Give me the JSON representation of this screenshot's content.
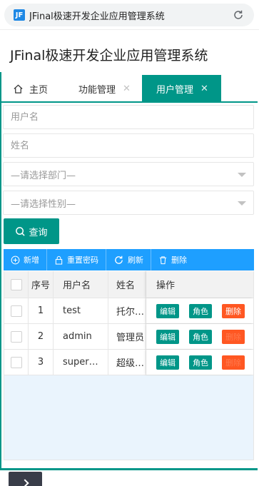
{
  "browser": {
    "address_text": "JFinal极速开发企业应用管理系统",
    "favicon_letter": "JF"
  },
  "app": {
    "title": "JFinal极速开发企业应用管理系统"
  },
  "tabs": [
    {
      "label": "主页",
      "closable": false,
      "active": false
    },
    {
      "label": "功能管理",
      "closable": true,
      "active": false
    },
    {
      "label": "用户管理",
      "closable": true,
      "active": true
    }
  ],
  "close_glyph": "✕",
  "form": {
    "username_placeholder": "用户名",
    "name_placeholder": "姓名",
    "department_value": "—请选择部门—",
    "gender_value": "—请选择性别—",
    "search_label": "查询"
  },
  "toolbar": {
    "add_label": "新增",
    "reset_password_label": "重置密码",
    "refresh_label": "刷新",
    "delete_label": "删除"
  },
  "table": {
    "headers": {
      "index": "序号",
      "username": "用户名",
      "name": "姓名",
      "actions": "操作"
    },
    "rows": [
      {
        "index": "1",
        "username": "test",
        "name": "托尔…"
      },
      {
        "index": "2",
        "username": "admin",
        "name": "管理员"
      },
      {
        "index": "3",
        "username": "super…",
        "name": "超级…"
      }
    ],
    "action_labels": {
      "edit": "编辑",
      "role": "角色",
      "delete": "删除"
    }
  },
  "colors": {
    "primary": "#009688",
    "toolbar": "#1e9fff",
    "danger": "#ff5722",
    "dark": "#393d49"
  },
  "icons": [
    "home-icon",
    "search-icon",
    "plus-icon",
    "lock-icon",
    "refresh-icon",
    "trash-icon",
    "reload-icon",
    "chevron-right-icon"
  ]
}
